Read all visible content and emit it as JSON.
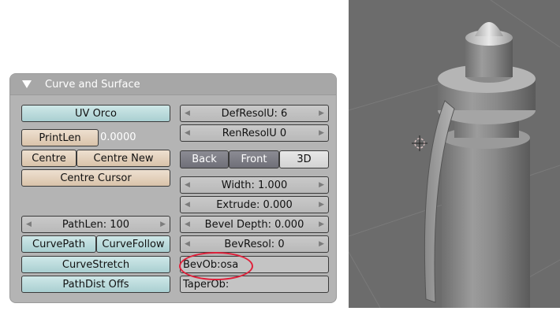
{
  "panel": {
    "title": "Curve and Surface",
    "uv_orco": "UV Orco",
    "print_len": "PrintLen",
    "print_len_value": "0.0000",
    "centre": "Centre",
    "centre_new": "Centre New",
    "centre_cursor": "Centre Cursor",
    "path_len": "PathLen: 100",
    "curve_path": "CurvePath",
    "curve_follow": "CurveFollow",
    "curve_stretch": "CurveStretch",
    "path_dist_offs": "PathDist Offs",
    "def_resol_u": "DefResolU: 6",
    "ren_resol_u": "RenResolU 0",
    "back": "Back",
    "front": "Front",
    "three_d": "3D",
    "width": "Width: 1.000",
    "extrude": "Extrude: 0.000",
    "bevel_depth": "Bevel Depth: 0.000",
    "bev_resol": "BevResol: 0",
    "bev_ob": "BevOb:osa",
    "taper_ob": "TaperOb:"
  },
  "colors": {
    "teal_button": "#b8dcdd",
    "tan_button": "#e4d2bd",
    "panel_bg": "#b4b4b4",
    "highlight_ellipse": "#e0203a",
    "viewport_bg": "#6c6c6c"
  },
  "icons": {
    "panel_toggle": "triangle-down-icon",
    "number_arrows": "arrow-left-right-icon",
    "cursor_3d": "crosshair-icon"
  }
}
